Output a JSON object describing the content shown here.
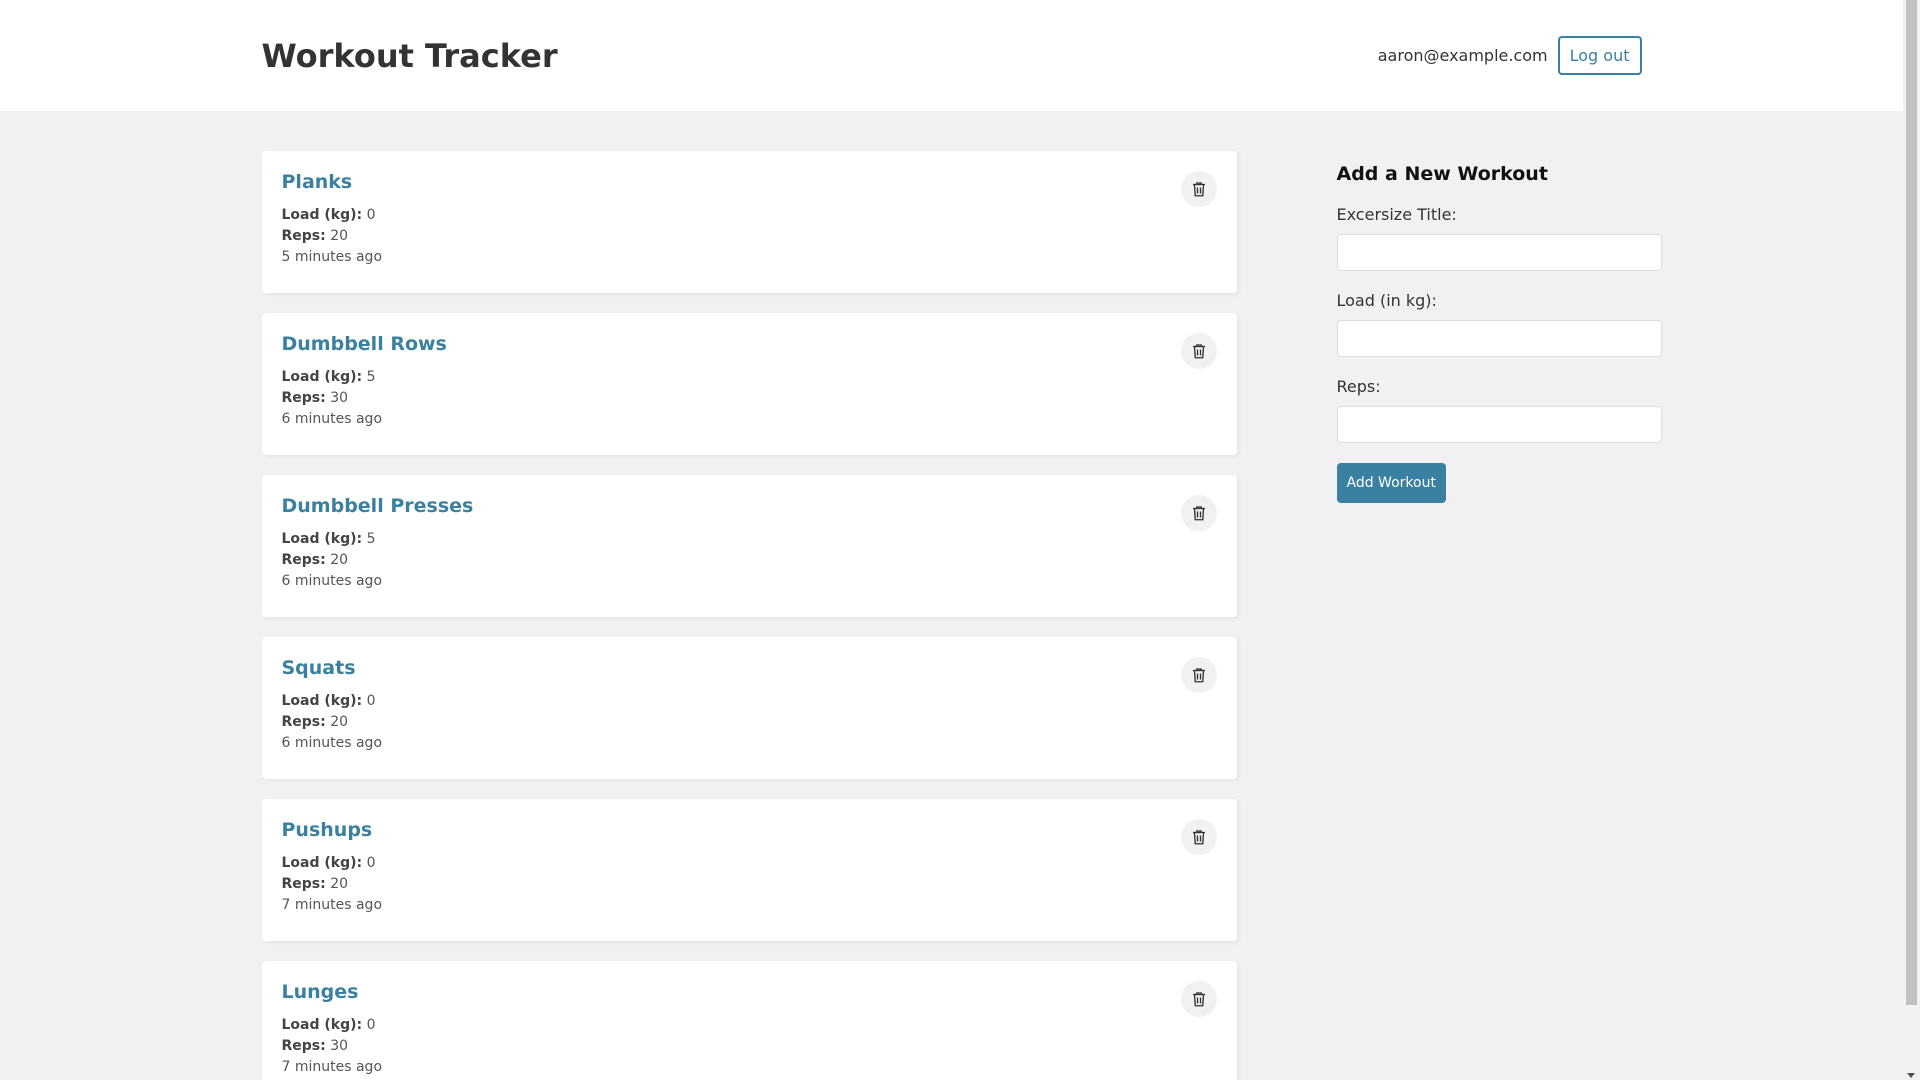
{
  "header": {
    "title": "Workout Tracker",
    "user_email": "aaron@example.com",
    "logout_label": "Log out"
  },
  "workouts": [
    {
      "title": "Planks",
      "load_label": "Load (kg):",
      "load": "0",
      "reps_label": "Reps:",
      "reps": "20",
      "time": "5 minutes ago"
    },
    {
      "title": "Dumbbell Rows",
      "load_label": "Load (kg):",
      "load": "5",
      "reps_label": "Reps:",
      "reps": "30",
      "time": "6 minutes ago"
    },
    {
      "title": "Dumbbell Presses",
      "load_label": "Load (kg):",
      "load": "5",
      "reps_label": "Reps:",
      "reps": "20",
      "time": "6 minutes ago"
    },
    {
      "title": "Squats",
      "load_label": "Load (kg):",
      "load": "0",
      "reps_label": "Reps:",
      "reps": "20",
      "time": "6 minutes ago"
    },
    {
      "title": "Pushups",
      "load_label": "Load (kg):",
      "load": "0",
      "reps_label": "Reps:",
      "reps": "20",
      "time": "7 minutes ago"
    },
    {
      "title": "Lunges",
      "load_label": "Load (kg):",
      "load": "0",
      "reps_label": "Reps:",
      "reps": "30",
      "time": "7 minutes ago"
    }
  ],
  "form": {
    "heading": "Add a New Workout",
    "title_label": "Excersize Title:",
    "title_value": "",
    "load_label": "Load (in kg):",
    "load_value": "",
    "reps_label": "Reps:",
    "reps_value": "",
    "submit_label": "Add Workout"
  },
  "icons": {
    "delete": "trash-icon"
  },
  "colors": {
    "accent": "#3a80a0",
    "background": "#f1f1f1"
  }
}
